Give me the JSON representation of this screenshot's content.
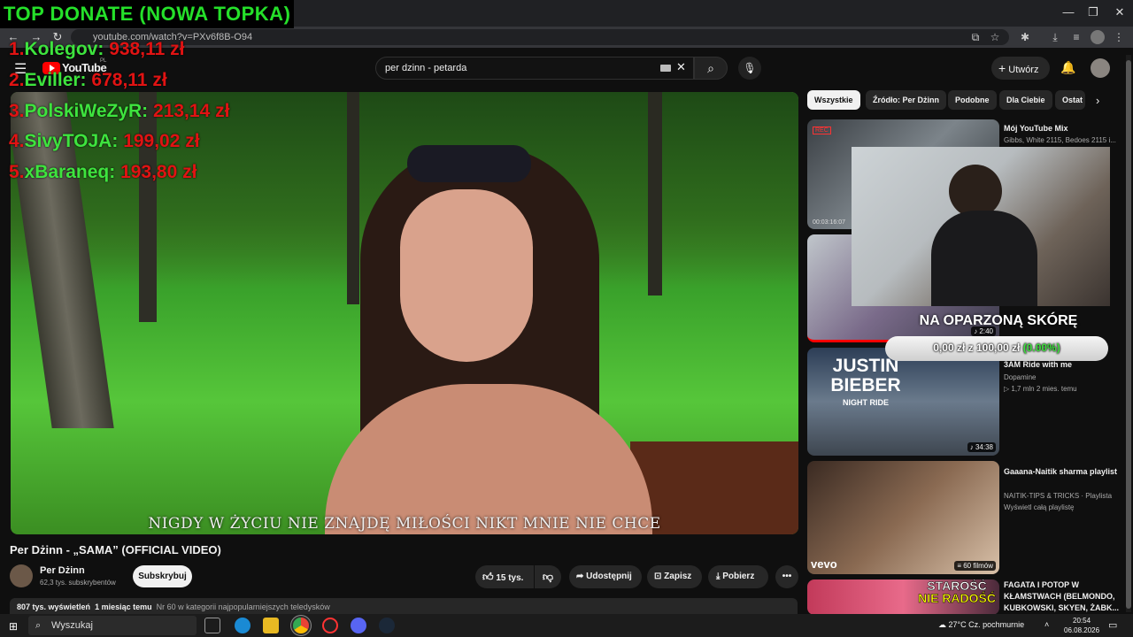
{
  "donate": {
    "title": "TOP DONATE (NOWA TOPKA)",
    "entries": [
      {
        "rank": "1.",
        "name": "Kolegov:",
        "amount": "938,11 zł"
      },
      {
        "rank": "2.",
        "name": "Eviller:",
        "amount": "678,11 zł"
      },
      {
        "rank": "3.",
        "name": "PolskiWeZyR:",
        "amount": "213,14 zł"
      },
      {
        "rank": "4.",
        "name": "SivyTOJA:",
        "amount": "199,02 zł"
      },
      {
        "rank": "5.",
        "name": "xBaraneq:",
        "amount": "193,80 zł"
      }
    ]
  },
  "browser": {
    "url": "youtube.com/watch?v=PXv6f8B-O94"
  },
  "header": {
    "logo": "YouTube",
    "logo_region": "PL",
    "search_value": "per dzinn - petarda",
    "create_label": "Utwórz"
  },
  "video": {
    "subtitle": "NIGDY W ŻYCIU NIE ZNAJDĘ MIŁOŚCI NIKT MNIE NIE CHCE",
    "title": "Per Dżinn - „SAMA” (OFFICIAL VIDEO)",
    "channel": "Per Dżinn",
    "subscribers": "62,3 tys. subskrybentów",
    "subscribe_label": "Subskrybuj",
    "likes": "15 tys.",
    "share_label": "Udostępnij",
    "save_label": "Zapisz",
    "download_label": "Pobierz",
    "views": "807 tys. wyświetleń",
    "age": "1 miesiąc temu",
    "rank_text": "Nr 60 w kategorii najpopularniejszych teledysków"
  },
  "chips": [
    "Wszystkie",
    "Źródło: Per Dżinn",
    "Podobne",
    "Dla Ciebie",
    "Ostat"
  ],
  "recommendations": [
    {
      "title": "Mój YouTube Mix",
      "meta": "Gibbs, White 2115, Bedoes 2115 i...",
      "duration": "00:03:16:07",
      "badge": "REC"
    },
    {
      "title": "",
      "meta": "",
      "duration": "2:40"
    },
    {
      "title": "3AM Ride with me",
      "channel": "Dopamine",
      "meta": "1,7 mln  2 mies. temu",
      "duration": "34:38",
      "thumb_text1": "JUSTIN",
      "thumb_text2": "BIEBER",
      "thumb_text3": "NIGHT RIDE"
    },
    {
      "title": "Gaaana-Naitik sharma playlist",
      "channel": "NAITIK-TIPS & TRICKS · Playlista",
      "meta": "Wyświetl całą playlistę",
      "duration": "60 filmów",
      "thumb_text1": "vevo"
    },
    {
      "title": "FAGATA I POTOP W KŁAMSTWACH (BELMONDO, KUBKOWSKI, SKYEN, ŻABK...",
      "thumb_text1": "STAROŚĆ",
      "thumb_text2": "NIE RADOŚĆ"
    }
  ],
  "goal": {
    "title": "NA OPARZONĄ SKÓRĘ",
    "current": "0,00 zł z 100,00 zł",
    "percent": "(0.00%)"
  },
  "taskbar": {
    "search_placeholder": "Wyszukaj",
    "weather": "27°C  Cz. pochmurnie",
    "time": "20:54",
    "date": "06.08.2026"
  },
  "colors": {
    "donate_green": "#25e02a",
    "donate_red": "#e01313",
    "yt_red": "#ff0000",
    "background": "#0f0f0f"
  }
}
